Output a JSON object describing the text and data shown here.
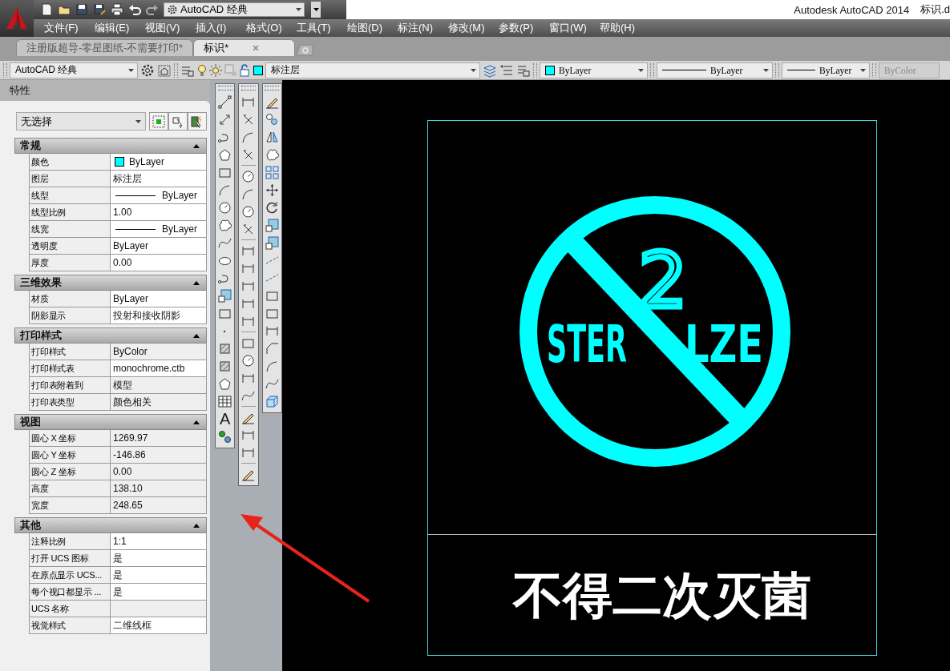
{
  "app": {
    "workspace": "AutoCAD 经典",
    "title": "Autodesk AutoCAD 2014",
    "file": "标识.d"
  },
  "menu": [
    "文件(F)",
    "编辑(E)",
    "视图(V)",
    "插入(I)",
    "格式(O)",
    "工具(T)",
    "绘图(D)",
    "标注(N)",
    "修改(M)",
    "参数(P)",
    "窗口(W)",
    "帮助(H)"
  ],
  "tabs": [
    {
      "label": "注册版超导-零星图纸-不需要打印*",
      "selected": false
    },
    {
      "label": "标识*",
      "selected": true
    }
  ],
  "toolbar": {
    "workspace": "AutoCAD 经典",
    "layer": "标注层",
    "object_color": "ByLayer",
    "linetype": "ByLayer",
    "lineweight": "ByLayer",
    "plot_style": {
      "value": "ByColor",
      "disabled": true
    }
  },
  "properties": {
    "title": "特性",
    "selection": "无选择",
    "sections": [
      {
        "title": "常规",
        "expanded": true,
        "rows": [
          {
            "label": "颜色",
            "value": "ByLayer",
            "kind": "swatch",
            "readonly": false
          },
          {
            "label": "图层",
            "value": "标注层",
            "kind": "text",
            "readonly": false
          },
          {
            "label": "线型",
            "value": "ByLayer",
            "kind": "line",
            "readonly": false
          },
          {
            "label": "线型比例",
            "value": "1.00",
            "kind": "text",
            "readonly": false
          },
          {
            "label": "线宽",
            "value": "ByLayer",
            "kind": "line",
            "readonly": false
          },
          {
            "label": "透明度",
            "value": "ByLayer",
            "kind": "text",
            "readonly": false
          },
          {
            "label": "厚度",
            "value": "0.00",
            "kind": "text",
            "readonly": false
          }
        ]
      },
      {
        "title": "三维效果",
        "expanded": true,
        "rows": [
          {
            "label": "材质",
            "value": "ByLayer",
            "kind": "text",
            "readonly": false
          },
          {
            "label": "阴影显示",
            "value": "投射和接收阴影",
            "kind": "text",
            "readonly": false
          }
        ]
      },
      {
        "title": "打印样式",
        "expanded": true,
        "rows": [
          {
            "label": "打印样式",
            "value": "ByColor",
            "kind": "text",
            "readonly": true
          },
          {
            "label": "打印样式表",
            "value": "monochrome.ctb",
            "kind": "text",
            "readonly": false
          },
          {
            "label": "打印表附着到",
            "value": "模型",
            "kind": "text",
            "readonly": true
          },
          {
            "label": "打印表类型",
            "value": "颜色相关",
            "kind": "text",
            "readonly": true
          }
        ]
      },
      {
        "title": "视图",
        "expanded": true,
        "rows": [
          {
            "label": "圆心 X 坐标",
            "value": "1269.97",
            "kind": "text",
            "readonly": true
          },
          {
            "label": "圆心 Y 坐标",
            "value": "-146.86",
            "kind": "text",
            "readonly": true
          },
          {
            "label": "圆心 Z 坐标",
            "value": "0.00",
            "kind": "text",
            "readonly": true
          },
          {
            "label": "高度",
            "value": "138.10",
            "kind": "text",
            "readonly": true
          },
          {
            "label": "宽度",
            "value": "248.65",
            "kind": "text",
            "readonly": true
          }
        ]
      },
      {
        "title": "其他",
        "expanded": true,
        "rows": [
          {
            "label": "注释比例",
            "value": "1:1",
            "kind": "text",
            "readonly": false
          },
          {
            "label": "打开 UCS 图标",
            "value": "是",
            "kind": "text",
            "readonly": false
          },
          {
            "label": "在原点显示 UCS...",
            "value": "是",
            "kind": "text",
            "readonly": false
          },
          {
            "label": "每个视口都显示 ...",
            "value": "是",
            "kind": "text",
            "readonly": false
          },
          {
            "label": "UCS 名称",
            "kind": "text",
            "readonly": true
          },
          {
            "label": "视觉样式",
            "value": "二维线框",
            "kind": "text",
            "readonly": false
          }
        ]
      }
    ]
  },
  "draw_tools": {
    "text_tool": "A"
  },
  "drawing": {
    "number": "2",
    "word_parts": [
      "STER",
      "LZE"
    ],
    "caption": "不得二次灭菌"
  }
}
